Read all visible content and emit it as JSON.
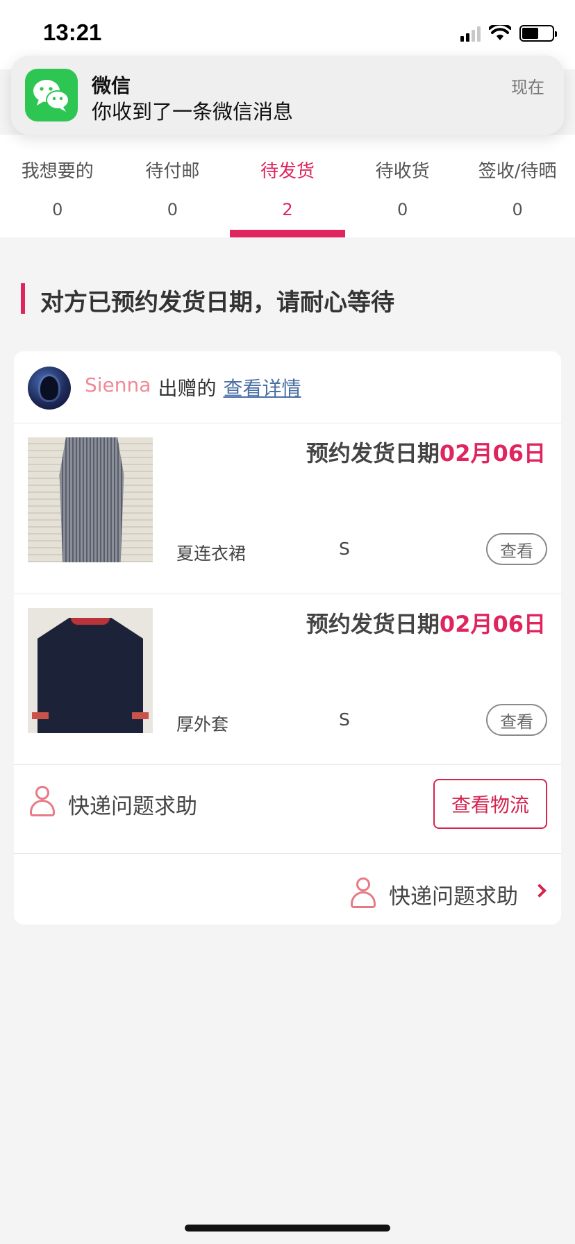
{
  "status_bar": {
    "time": "13:21"
  },
  "notification": {
    "app_name": "微信",
    "message": "你收到了一条微信消息",
    "time": "现在",
    "icon": "wechat-icon"
  },
  "tabs": [
    {
      "label": "我想要的",
      "count": "0"
    },
    {
      "label": "待付邮",
      "count": "0"
    },
    {
      "label": "待发货",
      "count": "2",
      "active": true
    },
    {
      "label": "待收货",
      "count": "0"
    },
    {
      "label": "签收/待晒",
      "count": "0"
    }
  ],
  "section": {
    "title": "对方已预约发货日期，请耐心等待"
  },
  "order": {
    "giver_name": "Sienna",
    "giver_verb": "出赠的",
    "detail_link": "查看详情",
    "items": [
      {
        "ship_label": "预约发货日期",
        "ship_date": "02月06日",
        "name": "夏连衣裙",
        "size": "S",
        "view_label": "查看"
      },
      {
        "ship_label": "预约发货日期",
        "ship_date": "02月06日",
        "name": "厚外套",
        "size": "S",
        "view_label": "查看"
      }
    ],
    "help_label": "快递问题求助",
    "logistics_button": "查看物流",
    "footer_help_label": "快递问题求助"
  },
  "colors": {
    "accent": "#e0245e",
    "giver_name": "#ef8a96",
    "link": "#4a6fa5",
    "wechat_green": "#2dc653"
  }
}
